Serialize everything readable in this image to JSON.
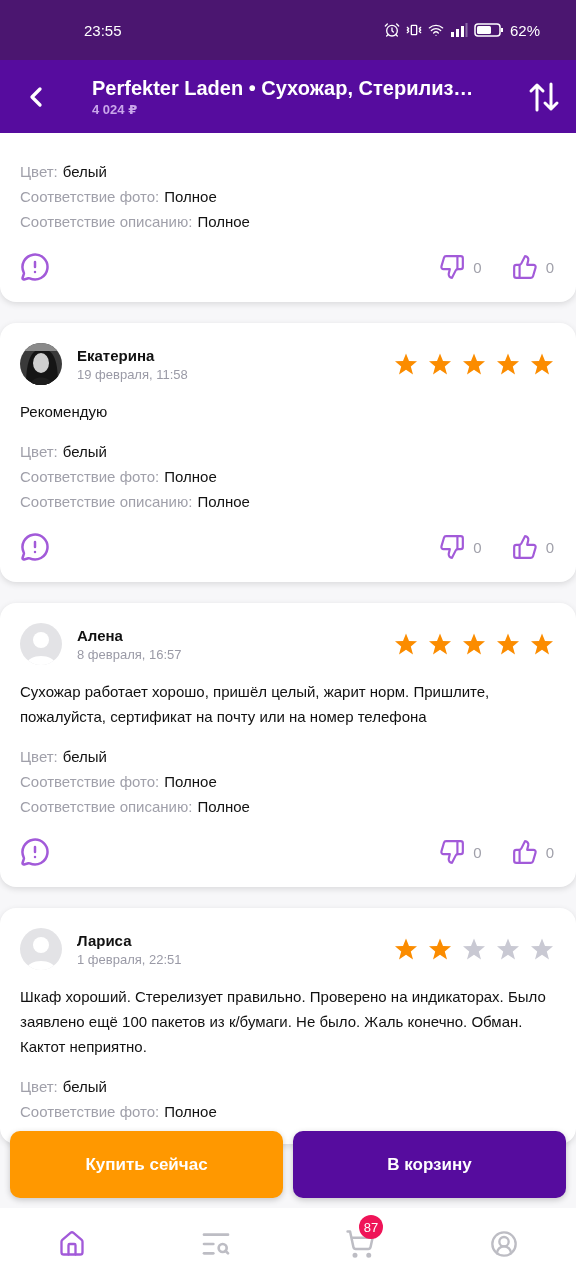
{
  "status_bar": {
    "time": "23:55",
    "battery": "62%"
  },
  "header": {
    "title": "Perfekter Laden • Сухожар, Стерилиз…",
    "price": "4 024 ₽"
  },
  "reviews": [
    {
      "kind": "partial",
      "attributes": [
        {
          "label": "Цвет:",
          "value": "белый"
        },
        {
          "label": "Соответствие фото:",
          "value": "Полное"
        },
        {
          "label": "Соответствие описанию:",
          "value": "Полное"
        }
      ],
      "dislikes": "0",
      "likes": "0"
    },
    {
      "kind": "full",
      "author": "Екатерина",
      "date": "19 февраля, 11:58",
      "has_photo": true,
      "stars": 5,
      "text": "Рекомендую",
      "attributes": [
        {
          "label": "Цвет:",
          "value": "белый"
        },
        {
          "label": "Соответствие фото:",
          "value": "Полное"
        },
        {
          "label": "Соответствие описанию:",
          "value": "Полное"
        }
      ],
      "dislikes": "0",
      "likes": "0"
    },
    {
      "kind": "full",
      "author": "Алена",
      "date": "8 февраля, 16:57",
      "has_photo": false,
      "stars": 5,
      "text": "Сухожар работает хорошо, пришёл целый, жарит норм. Пришлите, пожалуйста, сертификат на почту или на номер телефона",
      "attributes": [
        {
          "label": "Цвет:",
          "value": "белый"
        },
        {
          "label": "Соответствие фото:",
          "value": "Полное"
        },
        {
          "label": "Соответствие описанию:",
          "value": "Полное"
        }
      ],
      "dislikes": "0",
      "likes": "0"
    },
    {
      "kind": "full",
      "author": "Лариса",
      "date": "1 февраля, 22:51",
      "has_photo": false,
      "stars": 2,
      "text": "Шкаф хороший. Стерелизует правильно. Проверено на индикаторах. Было заявлено ещё 100 пакетов из к/бумаги. Не было. Жаль конечно. Обман. Кактот неприятно.",
      "attributes": [
        {
          "label": "Цвет:",
          "value": "белый"
        },
        {
          "label": "Соответствие фото:",
          "value": "Полное"
        }
      ]
    }
  ],
  "actions": [
    {
      "kind": "buy",
      "label": "Купить сейчас"
    },
    {
      "kind": "cart",
      "label": "В корзину"
    }
  ],
  "nav": [
    {
      "kind": "home",
      "selected": true
    },
    {
      "kind": "catalog",
      "selected": false
    },
    {
      "kind": "cart",
      "selected": false,
      "badge": "87"
    },
    {
      "kind": "profile",
      "selected": false
    }
  ]
}
